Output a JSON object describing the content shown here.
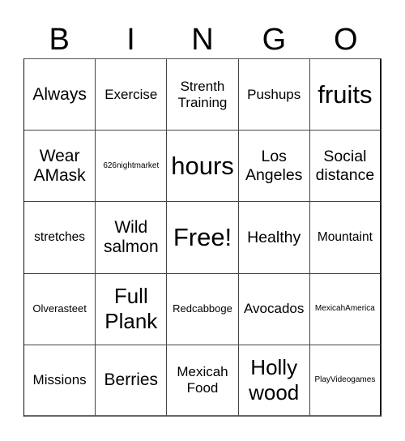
{
  "header": {
    "letters": [
      "B",
      "I",
      "N",
      "G",
      "O"
    ]
  },
  "board": {
    "rows": [
      [
        "Always",
        "Exercise",
        "Strenth Training",
        "Pushups",
        "fruits"
      ],
      [
        "Wear AMask",
        "626nightmarket",
        "hours",
        "Los Angeles",
        "Social distance"
      ],
      [
        "stretches",
        "Wild salmon",
        "Free!",
        "Healthy",
        "Mountaint"
      ],
      [
        "Olverasteet",
        "Full Plank",
        "Redcabboge",
        "Avocados",
        "MexicahAmerica"
      ],
      [
        "Missions",
        "Berries",
        "Mexicah Food",
        "Holly wood",
        "PlayVideogames"
      ]
    ]
  }
}
